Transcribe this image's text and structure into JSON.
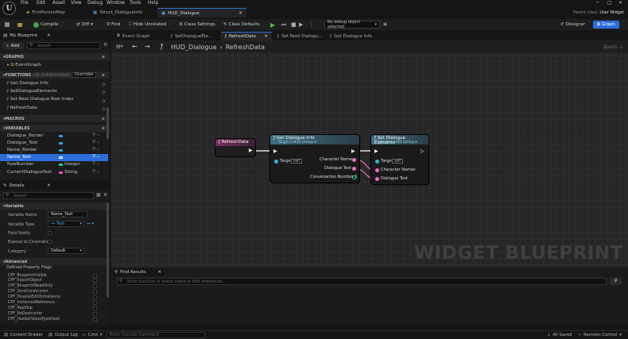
{
  "menu": [
    "File",
    "Edit",
    "Asset",
    "View",
    "Debug",
    "Window",
    "Tools",
    "Help"
  ],
  "window_controls": [
    "─",
    "□",
    "✕"
  ],
  "doc_tabs": [
    {
      "label": "FirstPersonMap",
      "active": false
    },
    {
      "label": "Struct_DialogueInfo",
      "active": false
    },
    {
      "label": "HUD_Dialogue",
      "active": true
    }
  ],
  "parent_class": {
    "label": "Parent class:",
    "value": "User Widget"
  },
  "toolbar": {
    "compile": "Compile",
    "find": "Find",
    "diff": "Diff",
    "hide_unrelated": "Hide Unrelated",
    "class_settings": "Class Settings",
    "class_defaults": "Class Defaults",
    "debug_select": "No debug object selected",
    "designer": "Designer",
    "graph": "Graph"
  },
  "my_blueprint": {
    "title": "My Blueprint",
    "add": "Add",
    "search_placeholder": "Search",
    "graphs_header": "GRAPHS",
    "event_graph": "EventGraph",
    "functions_header": "FUNCTIONS",
    "functions_count": "(29 OVERRIDABLE)",
    "override": "Override",
    "functions": [
      "Get Dialogue Info",
      "SetDialogueElements",
      "Set Next Dialogue Row Index",
      "RefreshData"
    ],
    "macros_header": "MACROS",
    "variables_header": "VARIABLES",
    "variables": [
      {
        "name": "Dialogue_Border",
        "type": "",
        "color": "#2aa4e0"
      },
      {
        "name": "Dialogue_Text",
        "type": "",
        "color": "#2aa4e0"
      },
      {
        "name": "Name_Border",
        "type": "",
        "color": "#2aa4e0"
      },
      {
        "name": "Name_Text",
        "type": "",
        "color": "#2aa4e0"
      },
      {
        "name": "RowNumber",
        "type": "Integer",
        "color": "#1dd3a6"
      },
      {
        "name": "CurrentDialogueText",
        "type": "String",
        "color": "#e64fbd"
      }
    ]
  },
  "details": {
    "title": "Details",
    "search_placeholder": "Search",
    "variable_header": "Variable",
    "fields": [
      {
        "label": "Variable Name",
        "value": "Name_Text"
      },
      {
        "label": "Variable Type",
        "value": "Text"
      },
      {
        "label": "Field Notify",
        "value": ""
      },
      {
        "label": "Expose to Cinematics",
        "value": ""
      },
      {
        "label": "Category",
        "value": "Default"
      }
    ],
    "advanced": "Advanced",
    "defined_flags": "Defined Property Flags",
    "flags": [
      "CPF_BlueprintVisible",
      "CPF_ExportObject",
      "CPF_BlueprintReadOnly",
      "CPF_ZeroConstructor",
      "CPF_DisableEditOnInstance",
      "CPF_InstancedReference",
      "CPF_RepSkip",
      "CPF_NoDestructor",
      "CPF_HasGetValueTypeHash"
    ]
  },
  "graph_tabs": [
    {
      "label": "Event Graph",
      "active": false
    },
    {
      "label": "SetDialogueEle...",
      "active": false
    },
    {
      "label": "RefreshData",
      "active": true
    },
    {
      "label": "Set Next Dialogu...",
      "active": false
    },
    {
      "label": "Get Dialogue Info",
      "active": false
    }
  ],
  "breadcrumb": {
    "root": "HUD_Dialogue",
    "sep": "›",
    "current": "RefreshData"
  },
  "zoom": "Zoom -1",
  "watermark": "WIDGET BLUEPRINT",
  "nodes": {
    "refresh": {
      "title": "RefreshData"
    },
    "get_info": {
      "title": "Get Dialogue Info",
      "subtitle": "Target is HUD Dialogue",
      "target": "Target",
      "self": "self",
      "out1": "Character Name",
      "out2": "Dialogue Text",
      "out3": "Conversation Number 1"
    },
    "set_elements": {
      "title": "Set Dialogue Elements",
      "subtitle": "Target is HUD Dialogue",
      "target": "Target",
      "self": "self",
      "in1": "Character Names",
      "in2": "Dialogue Text"
    }
  },
  "find_results": {
    "title": "Find Results",
    "placeholder": "Enter function or event name to find references..."
  },
  "status": {
    "content_drawer": "Content Drawer",
    "output_log": "Output Log",
    "cmd": "Cmd",
    "console_placeholder": "Enter Console Command",
    "all_saved": "All Saved",
    "revision_control": "Revision Control"
  },
  "colors": {
    "accent": "#2c6ed9",
    "func_header": "#3b5f73",
    "event_header": "#6a2d52",
    "exec": "#ffffff",
    "text_pin": "#e96fc4",
    "object_pin": "#31b3d4"
  }
}
